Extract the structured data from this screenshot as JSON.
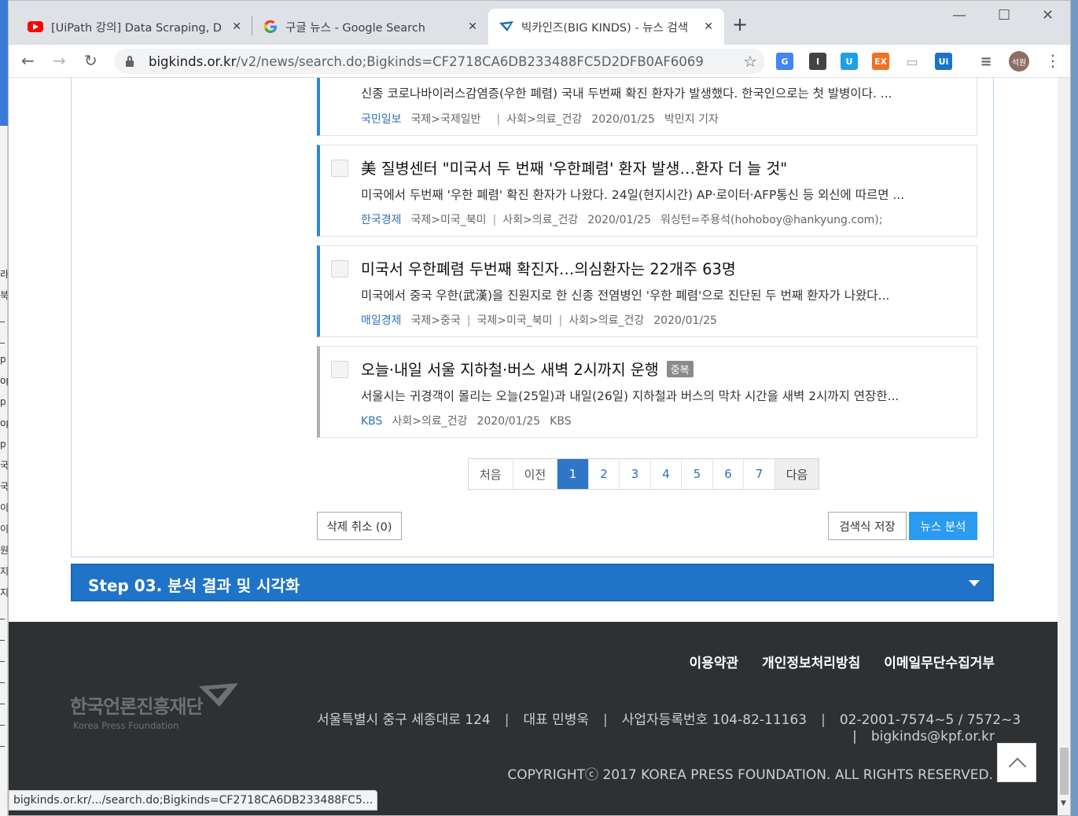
{
  "desktop": {
    "chars": [
      "라",
      "북",
      "_",
      "_",
      "p",
      "op",
      "p",
      "op",
      "p",
      "국",
      "국",
      "이",
      "이",
      "원",
      "지",
      "지",
      "_",
      "_",
      "_",
      "_",
      "_",
      "_",
      "_"
    ]
  },
  "browser": {
    "tabs": [
      {
        "title": "[UiPath 강의] Data Scraping, Da",
        "icon": "youtube-icon"
      },
      {
        "title": "구글 뉴스 - Google Search",
        "icon": "google-icon"
      },
      {
        "title": "빅카인즈(BIG KINDS) - 뉴스 검색",
        "icon": "bigkinds-icon"
      }
    ],
    "url_host": "bigkinds.or.kr",
    "url_path": "/v2/news/search.do;Bigkinds=CF2718CA6DB233488FC5D2DFB0AF6069",
    "extensions": [
      {
        "name": "google-translate-icon",
        "label": "G",
        "color": "#4285f4"
      },
      {
        "name": "instapaper-icon",
        "label": "I",
        "color": "#444444"
      },
      {
        "name": "shield-ext-icon",
        "label": "U",
        "color": "#1ea0e6"
      },
      {
        "name": "ex-ext-icon",
        "label": "EX",
        "color": "#f36f21"
      },
      {
        "name": "window-ext-icon",
        "label": "▭",
        "color": "#9e9e9e"
      },
      {
        "name": "uipath-ext-icon",
        "label": "Ui",
        "color": "#1a73c8"
      },
      {
        "name": "playlist-icon",
        "label": "≡",
        "color": "#5f6368"
      }
    ],
    "profile_label": "석원",
    "status_url": "bigkinds.or.kr/.../search.do;Bigkinds=CF2718CA6DB233488FC5..."
  },
  "articles": [
    {
      "headline": "",
      "summary": "신종 코로나바이러스감염증(우한 폐렴) 국내 두번째 확진 환자가 발생했다. 한국인으로는 첫 발병이다. ...",
      "press": "국민일보",
      "categories": [
        "국제>국제일반",
        "사회>의료_건강"
      ],
      "date": "2020/01/25",
      "byline": "박민지 기자",
      "duplicate": false
    },
    {
      "headline": "美 질병센터 \"미국서 두 번째 '우한폐렴' 환자 발생…환자 더 늘 것\"",
      "summary": "미국에서 두번째 '우한 폐렴' 확진 환자가 나왔다. 24일(현지시간) AP·로이터·AFP통신 등 외신에 따르면 ...",
      "press": "한국경제",
      "categories": [
        "국제>미국_북미",
        "사회>의료_건강"
      ],
      "date": "2020/01/25",
      "byline": "워싱턴=주용석(hohoboy@hankyung.com);",
      "duplicate": false
    },
    {
      "headline": "미국서 우한폐렴 두번째 확진자…의심환자는 22개주 63명",
      "summary": "미국에서 중국 우한(武漢)을 진원지로 한 신종 전염병인 '우한 폐렴'으로 진단된 두 번째 환자가 나왔다...",
      "press": "매일경제",
      "categories": [
        "국제>중국",
        "국제>미국_북미",
        "사회>의료_건강"
      ],
      "date": "2020/01/25",
      "byline": "",
      "duplicate": false
    },
    {
      "headline": "오늘·내일 서울 지하철·버스 새벽 2시까지 운행",
      "badge": "중복",
      "summary": "서울시는 귀경객이 몰리는 오늘(25일)과 내일(26일) 지하철과 버스의 막차 시간을 새벽 2시까지 연장한...",
      "press": "KBS",
      "categories": [
        "사회>의료_건강"
      ],
      "date": "2020/01/25",
      "byline": "KBS",
      "duplicate": true
    }
  ],
  "pagination": {
    "first": "처음",
    "prev": "이전",
    "pages": [
      "1",
      "2",
      "3",
      "4",
      "5",
      "6",
      "7"
    ],
    "current": "1",
    "next": "다음"
  },
  "buttons": {
    "undo_delete": "삭제 취소 (0)",
    "save_query": "검색식 저장",
    "news_analysis": "뉴스 분석"
  },
  "step3": {
    "label": "Step 03. 분석 결과 및 시각화"
  },
  "footer": {
    "links": [
      "이용약관",
      "개인정보처리방침",
      "이메일무단수집거부"
    ],
    "logo_ko": "한국언론진흥재단",
    "logo_en": "Korea Press Foundation",
    "address": "서울특별시 중구 세종대로 124",
    "ceo": "대표 민병욱",
    "biz_no": "사업자등록번호 104-82-11163",
    "phone": "02-2001-7574~5 / 7572~3",
    "email": "bigkinds@kpf.or.kr",
    "copyright": "COPYRIGHTⓒ 2017 KOREA PRESS FOUNDATION. ALL RIGHTS RESERVED."
  }
}
